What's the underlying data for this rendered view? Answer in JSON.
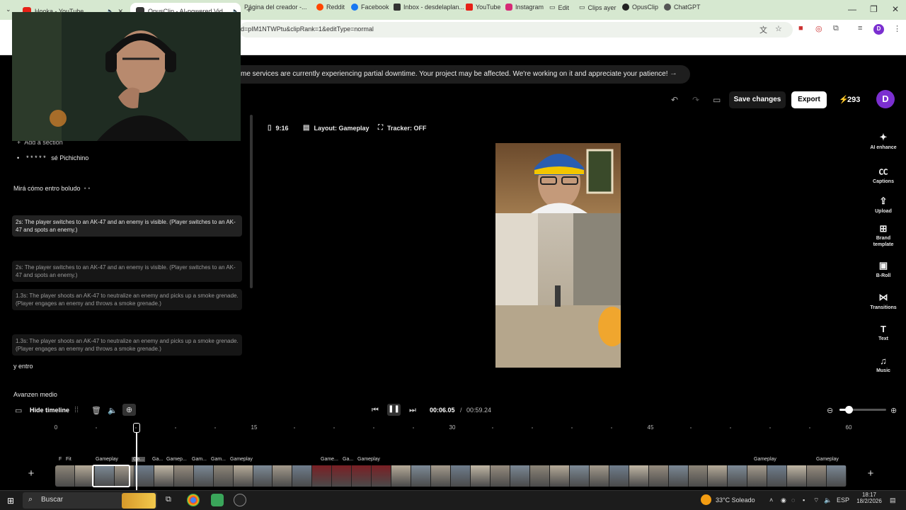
{
  "browser": {
    "tabs": [
      {
        "title": "Hooka - YouTube",
        "favicon_color": "#e62117"
      },
      {
        "title": "OpusClip - AI-powered Vid...",
        "favicon_color": "#333333"
      }
    ],
    "url": "d=pIM1NTWPtu&clipRank=1&editType=normal",
    "bookmarks": [
      {
        "label": "Página del creador -...",
        "color": "#888888"
      },
      {
        "label": "Reddit",
        "color": "#ff4500"
      },
      {
        "label": "Facebook",
        "color": "#1877f2"
      },
      {
        "label": "Inbox - desdelaplan...",
        "color": "#333333"
      },
      {
        "label": "YouTube",
        "color": "#e62117"
      },
      {
        "label": "Instagram",
        "color": "#d62976"
      },
      {
        "label": "Edit",
        "color": "#666666"
      },
      {
        "label": "Clips ayer",
        "color": "#666666"
      },
      {
        "label": "OpusClip",
        "color": "#222222"
      },
      {
        "label": "ChatGPT",
        "color": "#555555"
      }
    ],
    "profile_initial": "D"
  },
  "banner": {
    "text": "me services are currently experiencing partial downtime. Your project may be affected. We're working on it and appreciate your patience!"
  },
  "toolbar": {
    "save_label": "Save changes",
    "export_label": "Export",
    "credits": "293",
    "avatar": "D"
  },
  "options": {
    "aspect": "9:16",
    "layout": "Layout: Gameplay",
    "tracker": "Tracker: OFF"
  },
  "transcript": {
    "add_section": "Add a section",
    "stars": "* * * * *",
    "line1": "sé Pichichino",
    "line2": "Mirá cómo entro boludo",
    "line2_dots": "• •",
    "scenes": [
      "2s:  The player switches to an AK-47 and an enemy is visible. (Player switches to an AK-47 and spots an enemy.)",
      "2s:  The player switches to an AK-47 and an enemy is visible. (Player switches to an AK-47 and spots an enemy.)",
      "1.3s:  The player shoots an AK-47 to neutralize an enemy and picks up a smoke grenade. (Player engages an enemy and throws a smoke grenade.)",
      "1.3s:  The player shoots an AK-47 to neutralize an enemy and picks up a smoke grenade. (Player engages an enemy and throws a smoke grenade.)"
    ],
    "line3": "y entro",
    "line4": "Avanzen medio"
  },
  "tools": [
    {
      "label": "AI enhance",
      "icon": "sparkle-icon"
    },
    {
      "label": "Captions",
      "icon": "captions-icon"
    },
    {
      "label": "Upload",
      "icon": "upload-icon"
    },
    {
      "label": "Brand template",
      "icon": "brand-icon"
    },
    {
      "label": "B-Roll",
      "icon": "broll-icon"
    },
    {
      "label": "Transitions",
      "icon": "transitions-icon"
    },
    {
      "label": "Text",
      "icon": "text-icon"
    },
    {
      "label": "Music",
      "icon": "music-icon"
    }
  ],
  "timeline": {
    "hide_label": "Hide timeline",
    "current_time": "00:06.05",
    "separator": "/",
    "total_time": "00:59.24",
    "zoom_level": 0.2,
    "ruler": [
      "0",
      "15",
      "30",
      "45",
      "60"
    ],
    "segments": [
      {
        "label": "F"
      },
      {
        "label": "Fit"
      },
      {
        "label": "Gameplay"
      },
      {
        "label": "Ga..."
      },
      {
        "label": "Ga..."
      },
      {
        "label": "Gamep..."
      },
      {
        "label": "Gam..."
      },
      {
        "label": "Gam..."
      },
      {
        "label": "Gameplay"
      },
      {
        "label": "Game..."
      },
      {
        "label": "Ga..."
      },
      {
        "label": "Gameplay"
      },
      {
        "label": "Gameplay"
      },
      {
        "label": "Gameplay"
      }
    ]
  },
  "taskbar": {
    "search": "Buscar",
    "weather": "33°C  Soleado",
    "lang": "ESP",
    "time": "18:17",
    "date": "18/2/2026"
  }
}
